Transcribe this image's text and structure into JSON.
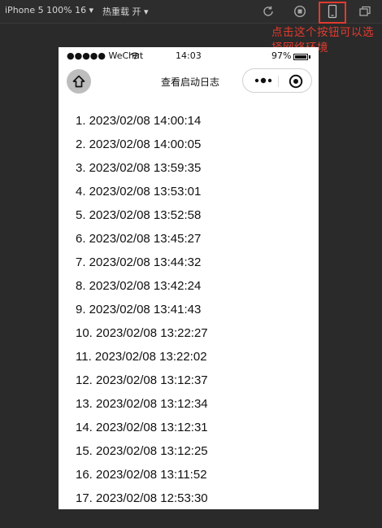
{
  "toolbar": {
    "device_label": "iPhone 5 100% 16 ▾",
    "hot_reload_label": "热重载 开 ▾",
    "icons": [
      "refresh-icon",
      "stop-record-icon",
      "phone-device-icon",
      "window-detach-icon"
    ]
  },
  "annotation": {
    "text": "点击这个按钮可以选择网络环境",
    "color": "#e23b2e"
  },
  "statusbar": {
    "carrier": "●●●●● WeChat",
    "time": "14:03",
    "battery": "97%"
  },
  "navbar": {
    "title": "查看启动日志"
  },
  "logs": [
    "1. 2023/02/08 14:00:14",
    "2. 2023/02/08 14:00:05",
    "3. 2023/02/08 13:59:35",
    "4. 2023/02/08 13:53:01",
    "5. 2023/02/08 13:52:58",
    "6. 2023/02/08 13:45:27",
    "7. 2023/02/08 13:44:32",
    "8. 2023/02/08 13:42:24",
    "9. 2023/02/08 13:41:43",
    "10. 2023/02/08 13:22:27",
    "11. 2023/02/08 13:22:02",
    "12. 2023/02/08 13:12:37",
    "13. 2023/02/08 13:12:34",
    "14. 2023/02/08 13:12:31",
    "15. 2023/02/08 13:12:25",
    "16. 2023/02/08 13:11:52",
    "17. 2023/02/08 12:53:30"
  ]
}
